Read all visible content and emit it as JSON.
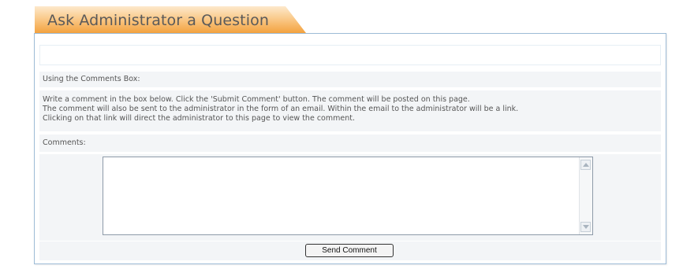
{
  "header": {
    "title": "Ask Administrator a Question"
  },
  "section": {
    "heading": "Using the Comments Box:",
    "description_lines": [
      "Write a comment in the box below. Click the 'Submit Comment' button. The comment will be posted on this page.",
      "The comment will also be sent to the administrator in the form of an email. Within the email to the administrator will be a link.",
      "Clicking on that link will direct the administrator to this page to view the comment."
    ],
    "comments_label": "Comments:"
  },
  "form": {
    "comment_value": "",
    "send_label": "Send Comment"
  },
  "colors": {
    "tab_gradient_top": "#fde7c4",
    "tab_gradient_bottom": "#f5a94a",
    "panel_border": "#9dbbd6",
    "row_background": "#f3f5f7"
  }
}
